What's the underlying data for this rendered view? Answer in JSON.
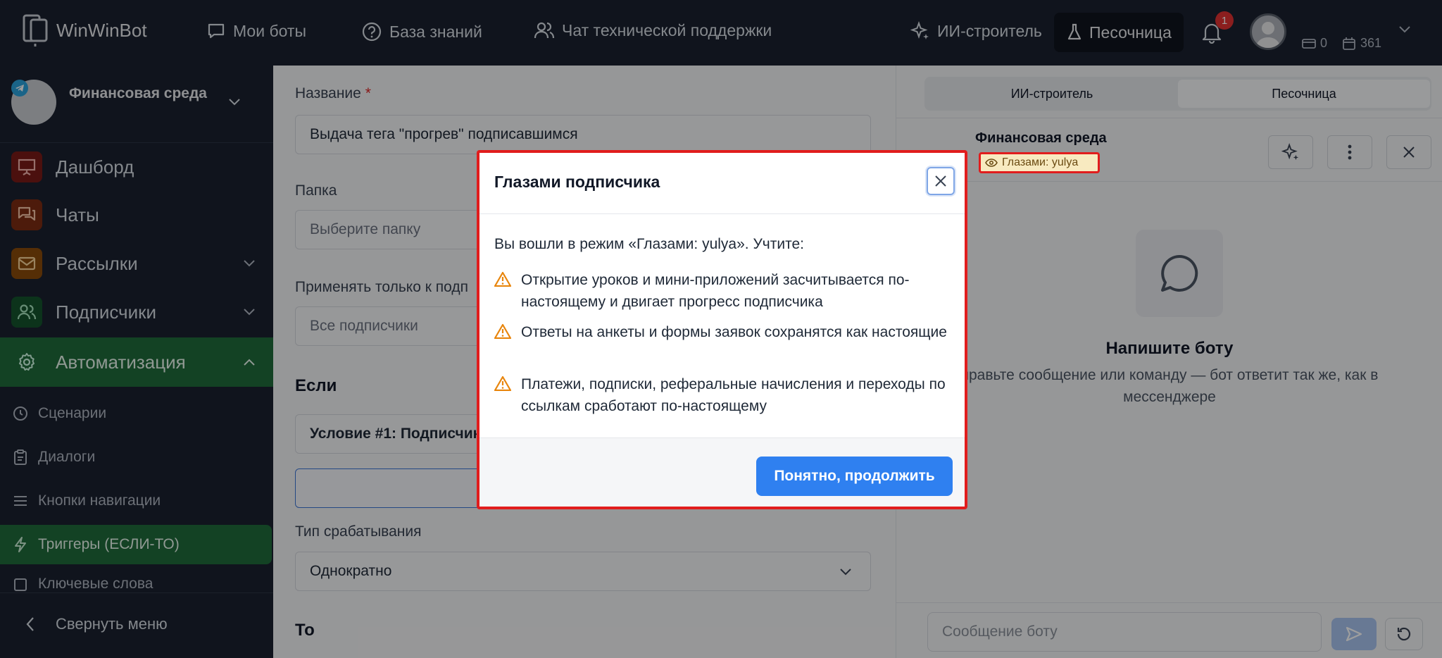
{
  "header": {
    "logo_text": "WinWinBot",
    "nav": [
      {
        "label": "Мои боты",
        "icon": "chat-icon"
      },
      {
        "label": "База знаний",
        "icon": "help-circle-icon"
      },
      {
        "label": "Чат технической поддержки",
        "icon": "users-icon"
      }
    ],
    "ai_builder": "ИИ-строитель",
    "sandbox": "Песочница",
    "notifications_count": "1",
    "balance": "0",
    "days": "361"
  },
  "sidebar": {
    "bot_name": "Финансовая среда",
    "items": [
      {
        "label": "Дашборд",
        "icon": "presentation-icon",
        "color": "#b42318"
      },
      {
        "label": "Чаты",
        "icon": "chats-icon",
        "color": "#c2410c"
      },
      {
        "label": "Рассылки",
        "icon": "mail-icon",
        "color": "#d97706"
      },
      {
        "label": "Подписчики",
        "icon": "users-icon",
        "color": "#15803d"
      },
      {
        "label": "Автоматизация",
        "icon": "gear-icon",
        "color": "#166534"
      }
    ],
    "sub_items": [
      {
        "label": "Сценарии",
        "icon": "clock-icon"
      },
      {
        "label": "Диалоги",
        "icon": "clipboard-icon"
      },
      {
        "label": "Кнопки навигации",
        "icon": "menu-icon"
      },
      {
        "label": "Триггеры (ЕСЛИ-ТО)",
        "icon": "bolt-icon"
      },
      {
        "label": "Ключевые слова",
        "icon": "square-icon"
      }
    ],
    "collapse_label": "Свернуть меню"
  },
  "form": {
    "name_label": "Название",
    "required_mark": "*",
    "name_value": "Выдача тега \"прогрев\" подписавшимся",
    "folder_label": "Папка",
    "folder_placeholder": "Выберите папку",
    "apply_label": "Применять только к подп",
    "apply_value": "Все подписчики",
    "if_title": "Если",
    "condition_text": "Условие #1: Подписчик",
    "trigger_type_label": "Тип срабатывания",
    "trigger_type_value": "Однократно",
    "then_title": "То"
  },
  "right_panel": {
    "tab_ai": "ИИ-строитель",
    "tab_sandbox": "Песочница",
    "bot_name": "Финансовая среда",
    "eyes_badge": "Глазами: yulya",
    "empty_title": "Напишите боту",
    "empty_text_line1": "правьте сообщение или команду — бот ответит так же, как в",
    "empty_text_line2": "мессенджере",
    "message_placeholder": "Сообщение боту"
  },
  "modal": {
    "title": "Глазами подписчика",
    "intro": "Вы вошли в режим «Глазами: yulya». Учтите:",
    "warnings": [
      "Открытие уроков и мини-приложений засчитывается по-настоящему и двигает прогресс подписчика",
      "Ответы на анкеты и формы заявок сохранятся как настоящие",
      "Платежи, подписки, реферальные начисления и переходы по ссылкам сработают по-настоящему"
    ],
    "confirm_button": "Понятно, продолжить"
  },
  "colors": {
    "accent": "#2f80f0",
    "highlight": "#e11d1d",
    "sidebar_bg": "#1a2130",
    "active_green": "#1f6b3a"
  }
}
